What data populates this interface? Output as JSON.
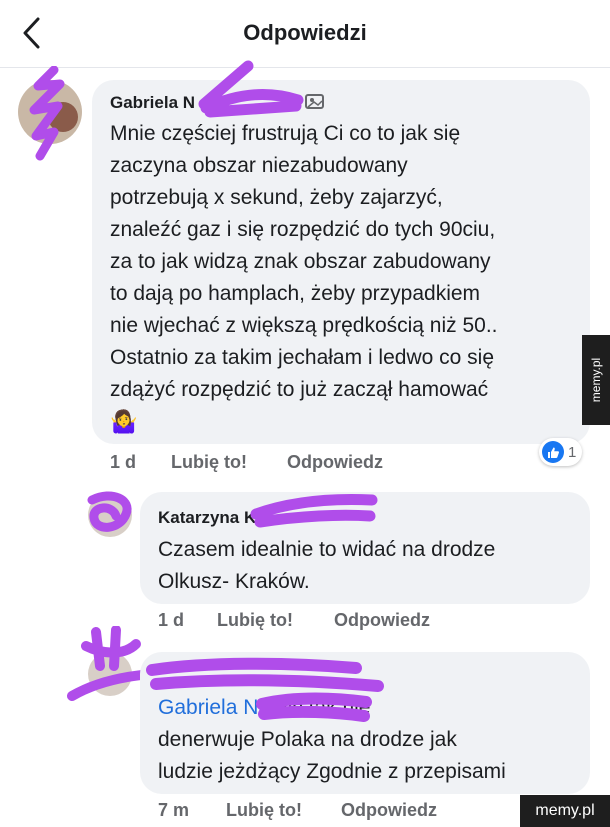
{
  "header": {
    "title": "Odpowiedzi"
  },
  "comments": [
    {
      "author": "Gabriela N",
      "text_lines": [
        "Mnie częściej frustrują Ci co to jak się",
        "zaczyna obszar niezabudowany",
        "potrzebują x sekund, żeby zajarzyć,",
        "znaleźć gaz i się rozpędzić do tych 90ciu,",
        "za to jak widzą znak obszar zabudowany",
        "to dają po hamplach, żeby przypadkiem",
        "nie wjechać z większą prędkością niż 50..",
        "Ostatnio za takim jechałam i ledwo co się",
        "zdążyć rozpędzić to już zaczął hamować"
      ],
      "emoji": "🤷‍♀️",
      "time": "1 d",
      "like_label": "Lubię to!",
      "reply_label": "Odpowiedz",
      "reaction_count": "1"
    },
    {
      "author": "Katarzyna K",
      "text_lines": [
        "Czasem idealnie to widać na drodze",
        "Olkusz- Kraków."
      ],
      "time": "1 d",
      "like_label": "Lubię to!",
      "reply_label": "Odpowiedz"
    },
    {
      "mention": "Gabriela N",
      "mention_tail": "a",
      "text_first": " nic tak nie",
      "text_lines": [
        "denerwuje Polaka na drodze jak",
        "ludzie jeżdżący Zgodnie z przepisami"
      ],
      "time": "7 m",
      "like_label": "Lubię to!",
      "reply_label": "Odpowiedz"
    }
  ],
  "watermark": {
    "side": "memy.pl",
    "bottom": "memy.pl"
  },
  "colors": {
    "scribble": "#b04dea",
    "bubble": "#f0f2f5",
    "link": "#216fdb",
    "like": "#1877f2"
  }
}
